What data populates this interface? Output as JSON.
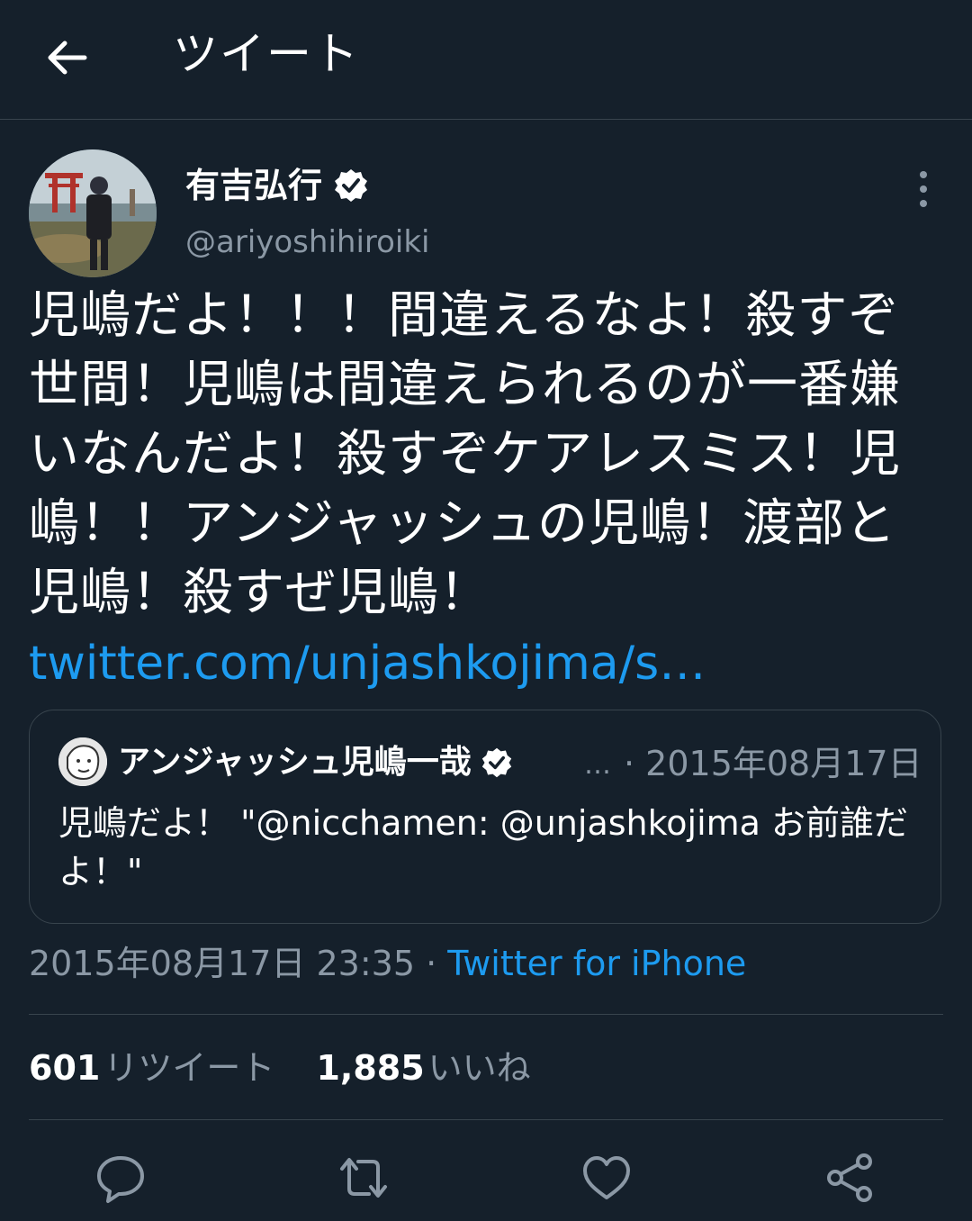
{
  "header": {
    "title": "ツイート",
    "back_icon": "arrow-left-icon"
  },
  "tweet": {
    "author_name": "有吉弘行",
    "author_handle": "@ariyoshihiroiki",
    "text": "児嶋だよ！！！間違えるなよ！殺すぞ世間！児嶋は間違えられるのが一番嫌いなんだよ！殺すぞケアレスミス！児嶋！！アンジャッシュの児嶋！渡部と児嶋！殺すぜ児嶋！",
    "link": "twitter.com/unjashkojima/s…",
    "timestamp": "2015年08月17日 23:35",
    "separator": " · ",
    "client": "Twitter for iPhone"
  },
  "quote": {
    "author_name": "アンジャッシュ児嶋一哉",
    "ellipsis": "…",
    "date": "· 2015年08月17日",
    "text": "児嶋だよ！ \"@nicchamen: @unjashkojima お前誰だよ！\""
  },
  "stats": {
    "retweets_count": "601",
    "retweets_label": "リツイート",
    "likes_count": "1,885",
    "likes_label": "いいね"
  },
  "actions": [
    "reply-icon",
    "retweet-icon",
    "like-icon",
    "share-icon"
  ],
  "colors": {
    "background": "#15202b",
    "accent": "#1d9bf0",
    "secondary_text": "#8b98a5",
    "divider": "#38444d"
  }
}
